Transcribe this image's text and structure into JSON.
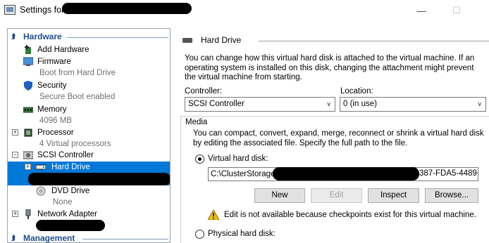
{
  "window": {
    "title": "Settings for",
    "minimize_glyph": "—",
    "maximize_glyph": "☐"
  },
  "tree": {
    "hardware_header": "Hardware",
    "management_header": "Management",
    "items": [
      {
        "label": "Add Hardware",
        "icon": "add-hardware-icon"
      },
      {
        "label": "Firmware",
        "sub": "Boot from Hard Drive",
        "icon": "firmware-icon"
      },
      {
        "label": "Security",
        "sub": "Secure Boot enabled",
        "icon": "shield-icon"
      },
      {
        "label": "Memory",
        "sub": "4096 MB",
        "icon": "memory-icon"
      },
      {
        "label": "Processor",
        "sub": "4 Virtual processors",
        "icon": "processor-icon"
      },
      {
        "label": "SCSI Controller",
        "icon": "scsi-controller-icon"
      },
      {
        "label": "Hard Drive",
        "icon": "hard-drive-icon"
      },
      {
        "label": "DVD Drive",
        "sub": "None",
        "icon": "dvd-icon"
      },
      {
        "label": "Network Adapter",
        "icon": "network-adapter-icon"
      }
    ]
  },
  "panel": {
    "title": "Hard Drive",
    "description": "You can change how this virtual hard disk is attached to the virtual machine. If an operating system is installed on this disk, changing the attachment might prevent the virtual machine from starting.",
    "controller_label": "Controller:",
    "controller_value": "SCSI Controller",
    "location_label": "Location:",
    "location_value": "0 (in use)",
    "media_label": "Media",
    "media_description": "You can compact, convert, expand, merge, reconnect or shrink a virtual hard disk by editing the associated file. Specify the full path to the file.",
    "virtual_disk_label": "Virtual hard disk:",
    "path_prefix": "C:\\ClusterStorage",
    "path_suffix": "387-FDA5-4489-",
    "buttons": {
      "new": "New",
      "edit": "Edit",
      "inspect": "Inspect",
      "browse": "Browse..."
    },
    "warning": "Edit is not available because checkpoints exist for this virtual machine.",
    "physical_disk_label": "Physical hard disk:"
  },
  "colors": {
    "selection": "#0078d7",
    "section_header": "#1e4e8c",
    "secondary_text": "#707070"
  }
}
